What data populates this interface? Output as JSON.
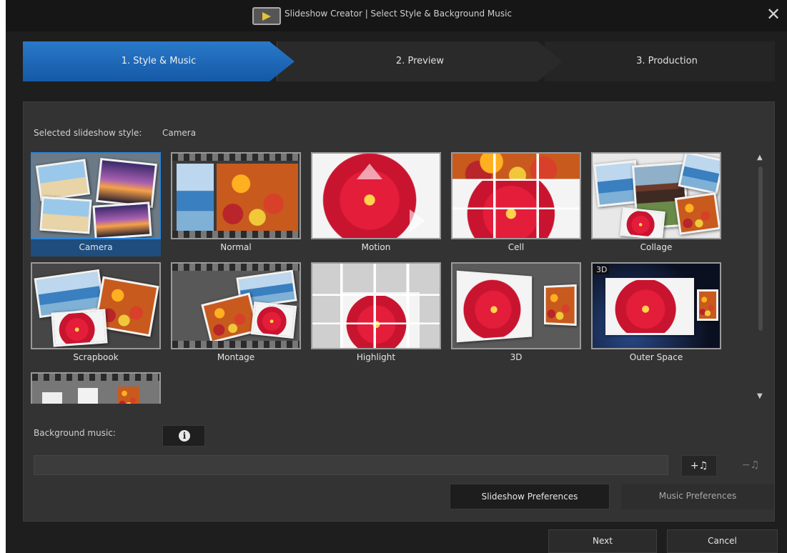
{
  "window": {
    "title": "Slideshow Creator | Select Style & Background Music",
    "close_glyph": "✕",
    "app_icon": "slideshow-app-icon"
  },
  "steps": [
    {
      "label": "1. Style & Music",
      "active": true
    },
    {
      "label": "2. Preview",
      "active": false
    },
    {
      "label": "3. Production",
      "active": false
    }
  ],
  "style_section": {
    "label": "Selected slideshow style:",
    "value": "Camera"
  },
  "styles": [
    {
      "label": "Camera",
      "selected": true
    },
    {
      "label": "Normal"
    },
    {
      "label": "Motion"
    },
    {
      "label": "Cell"
    },
    {
      "label": "Collage"
    },
    {
      "label": "Scrapbook"
    },
    {
      "label": "Montage"
    },
    {
      "label": "Highlight"
    },
    {
      "label": "3D"
    },
    {
      "label": "Outer Space",
      "badge": "3D"
    },
    {
      "label": ""
    }
  ],
  "scrollbar": {
    "up_glyph": "▲",
    "down_glyph": "▼"
  },
  "music": {
    "label": "Background music:",
    "info_glyph": "i",
    "field_value": "",
    "add_glyph": "+♫",
    "remove_glyph": "−♫"
  },
  "buttons": {
    "slideshow_preferences": "Slideshow Preferences",
    "music_preferences": "Music Preferences",
    "next": "Next",
    "cancel": "Cancel"
  }
}
